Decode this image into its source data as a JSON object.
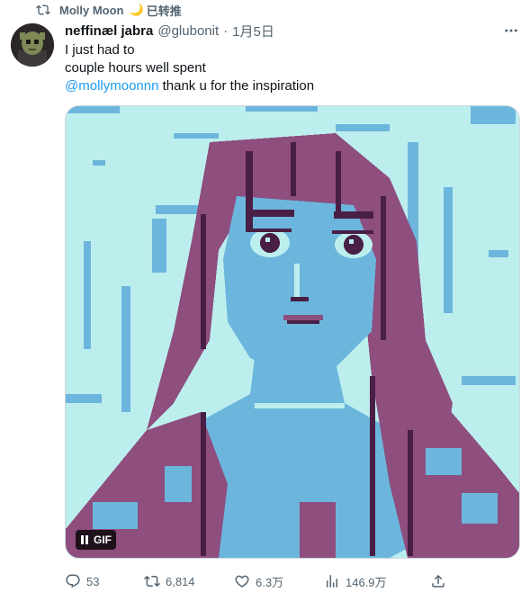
{
  "retweet": {
    "name": "Molly Moon",
    "suffix": "已转推",
    "icon": "retweet-icon"
  },
  "tweet": {
    "display_name": "neffinæl jabra",
    "handle": "@glubonit",
    "separator": "·",
    "date": "1月5日",
    "lines": [
      "I just had to",
      "couple hours well spent"
    ],
    "mention": "@mollymoonnn",
    "mention_rest": " thank u for the inspiration"
  },
  "media": {
    "badge_label": "GIF",
    "palette": {
      "light": "#bdeeee",
      "mid": "#6cb6dd",
      "dark": "#8e4e7e",
      "darkest": "#4a1f45"
    }
  },
  "actions": {
    "replies": "53",
    "retweets": "6,814",
    "likes": "6.3万",
    "views": "146.9万"
  },
  "colors": {
    "accent": "#1d9bf0",
    "muted": "#536471",
    "text": "#0f1419"
  }
}
